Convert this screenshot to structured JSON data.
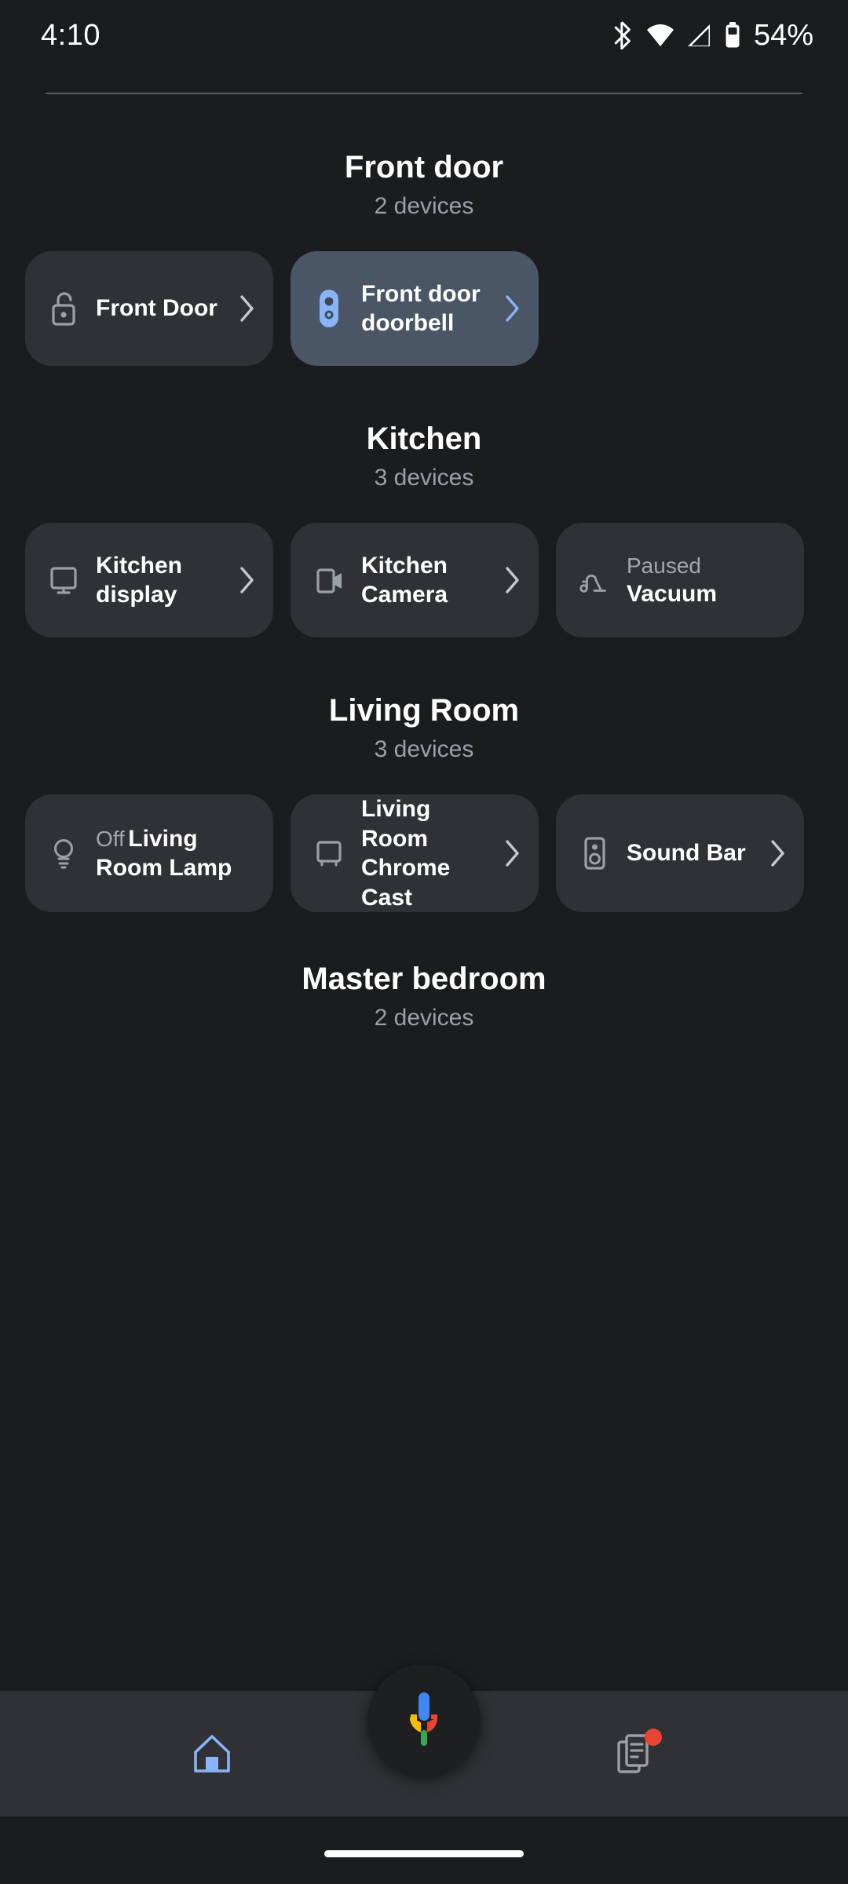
{
  "status_bar": {
    "time": "4:10",
    "battery_percent": "54%",
    "icons": [
      "bluetooth-icon",
      "wifi-icon",
      "cellular-signal-icon",
      "battery-icon"
    ]
  },
  "sections": [
    {
      "title": "Front door",
      "subtitle": "2 devices",
      "devices": [
        {
          "label": "Front Door",
          "state": "",
          "icon": "lock-open-icon",
          "chevron": true,
          "highlight": false
        },
        {
          "label": "Front door doorbell",
          "state": "",
          "icon": "doorbell-icon",
          "chevron": true,
          "highlight": true
        }
      ]
    },
    {
      "title": "Kitchen",
      "subtitle": "3 devices",
      "devices": [
        {
          "label": "Kitchen display",
          "state": "",
          "icon": "display-icon",
          "chevron": true,
          "highlight": false
        },
        {
          "label": "Kitchen Camera",
          "state": "",
          "icon": "camera-icon",
          "chevron": true,
          "highlight": false
        },
        {
          "label": "Vacuum",
          "state": "Paused",
          "icon": "vacuum-icon",
          "chevron": false,
          "highlight": false
        }
      ]
    },
    {
      "title": "Living Room",
      "subtitle": "3 devices",
      "devices": [
        {
          "label": "Living Room Lamp",
          "state": "Off",
          "icon": "lightbulb-icon",
          "chevron": false,
          "highlight": false
        },
        {
          "label": "Living Room Chrome Cast",
          "state": "",
          "icon": "chromecast-icon",
          "chevron": true,
          "highlight": false
        },
        {
          "label": "Sound Bar",
          "state": "",
          "icon": "speaker-icon",
          "chevron": true,
          "highlight": false
        }
      ]
    },
    {
      "title": "Master bedroom",
      "subtitle": "2 devices",
      "devices": []
    }
  ],
  "fab": {
    "icon": "google-assistant-mic-icon",
    "label": ""
  },
  "bottom_nav": {
    "items": [
      {
        "icon": "home-icon",
        "label": "",
        "active": true,
        "badge": false
      },
      {
        "icon": "feed-icon",
        "label": "",
        "active": false,
        "badge": true
      }
    ]
  },
  "colors": {
    "background": "#1b1c1e",
    "card": "#303134",
    "card_highlight": "#4a5565",
    "accent_blue": "#8ab4f8",
    "text_primary": "#ffffff",
    "text_secondary": "#9aa0a6",
    "badge_red": "#ea4335"
  }
}
